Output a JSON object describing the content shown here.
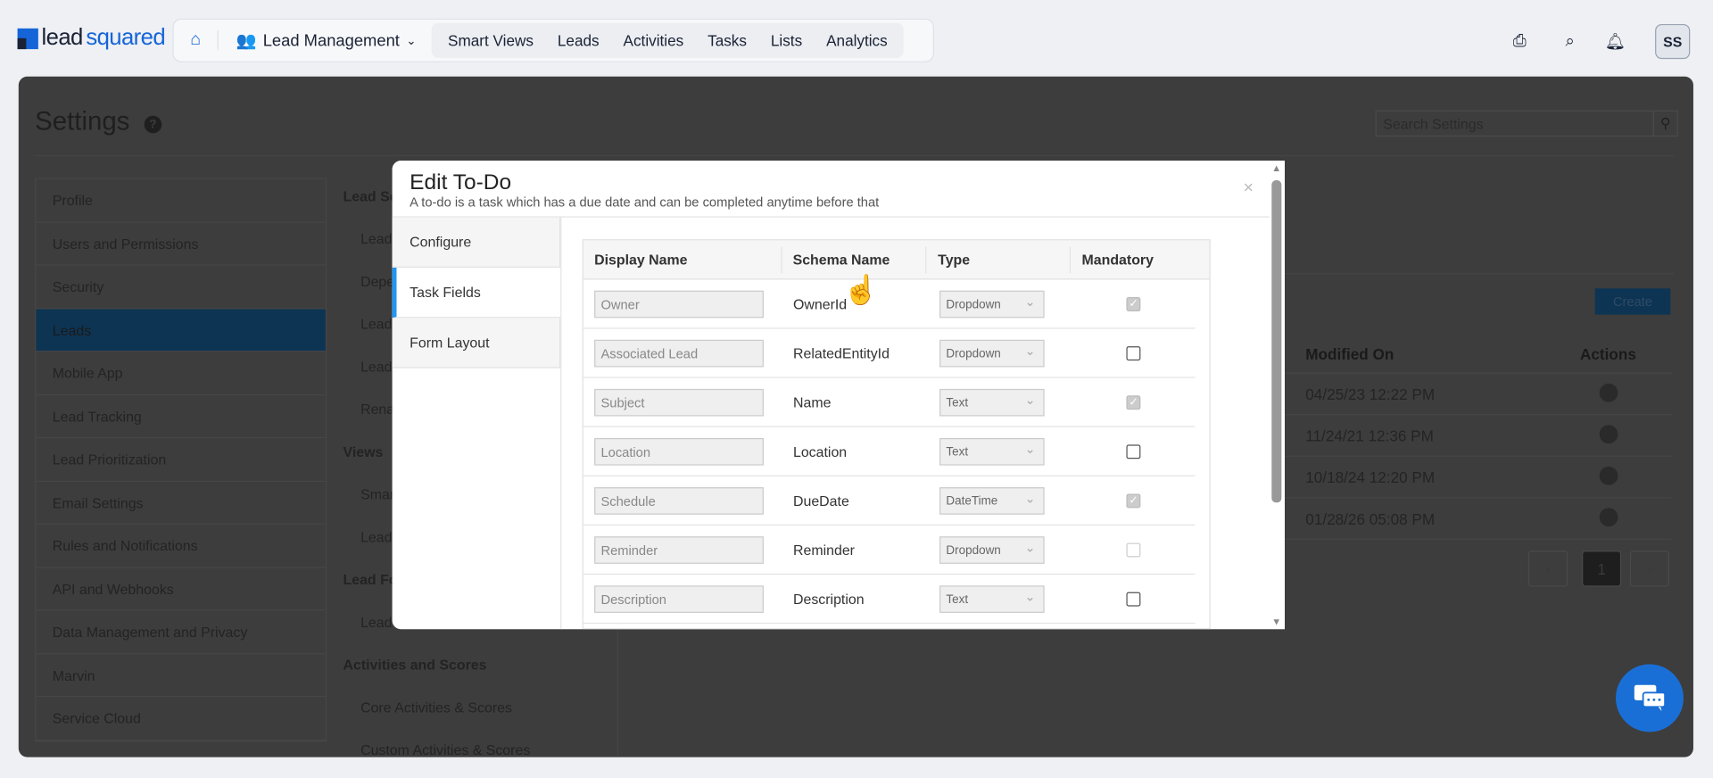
{
  "brand": {
    "logo_part1": "lead",
    "logo_part2": "squared"
  },
  "topnav": {
    "module": "Lead Management",
    "links": [
      "Smart Views",
      "Leads",
      "Activities",
      "Tasks",
      "Lists",
      "Analytics"
    ],
    "avatar": "SS"
  },
  "settings": {
    "title": "Settings",
    "search_placeholder": "Search Settings",
    "sidebar": [
      "Profile",
      "Users and Permissions",
      "Security",
      "Leads",
      "Mobile App",
      "Lead Tracking",
      "Lead Prioritization",
      "Email Settings",
      "Rules and Notifications",
      "API and Webhooks",
      "Data Management and Privacy",
      "Marvin",
      "Service Cloud"
    ],
    "mid": {
      "h1": "Lead Se",
      "items1": [
        "Lead",
        "Depe",
        "Lead",
        "Lead",
        "Rena"
      ],
      "h2": "Views",
      "items2": [
        "Smar",
        "Lead"
      ],
      "h3": "Lead Fo",
      "items3": [
        "Lead Forms"
      ],
      "h4": "Activities and Scores",
      "items4": [
        "Core Activities & Scores",
        "Custom Activities & Scores"
      ]
    },
    "create_label": "Create",
    "table": {
      "headers": [
        "Modified On",
        "Actions"
      ],
      "rows": [
        "04/25/23 12:22 PM",
        "11/24/21 12:36 PM",
        "10/18/24 12:20 PM",
        "01/28/26 05:08 PM"
      ]
    },
    "page": "1"
  },
  "modal": {
    "title": "Edit To-Do",
    "subtitle": "A to-do is a task which has a due date and can be completed anytime before that",
    "tabs": [
      "Configure",
      "Task Fields",
      "Form Layout"
    ],
    "headers": [
      "Display Name",
      "Schema Name",
      "Type",
      "Mandatory"
    ],
    "rows": [
      {
        "display": "Owner",
        "schema": "OwnerId",
        "type": "Dropdown",
        "mandatory": "checked-disabled"
      },
      {
        "display": "Associated Lead",
        "schema": "RelatedEntityId",
        "type": "Dropdown",
        "mandatory": "unchecked"
      },
      {
        "display": "Subject",
        "schema": "Name",
        "type": "Text",
        "mandatory": "checked-disabled"
      },
      {
        "display": "Location",
        "schema": "Location",
        "type": "Text",
        "mandatory": "unchecked"
      },
      {
        "display": "Schedule",
        "schema": "DueDate",
        "type": "DateTime",
        "mandatory": "checked-disabled"
      },
      {
        "display": "Reminder",
        "schema": "Reminder",
        "type": "Dropdown",
        "mandatory": "unchecked-disabled"
      },
      {
        "display": "Description",
        "schema": "Description",
        "type": "Text",
        "mandatory": "unchecked"
      }
    ]
  },
  "colors": {
    "brand": "#1565d8",
    "tab_active": "#2196f3",
    "chat": "#1a6fd6"
  }
}
